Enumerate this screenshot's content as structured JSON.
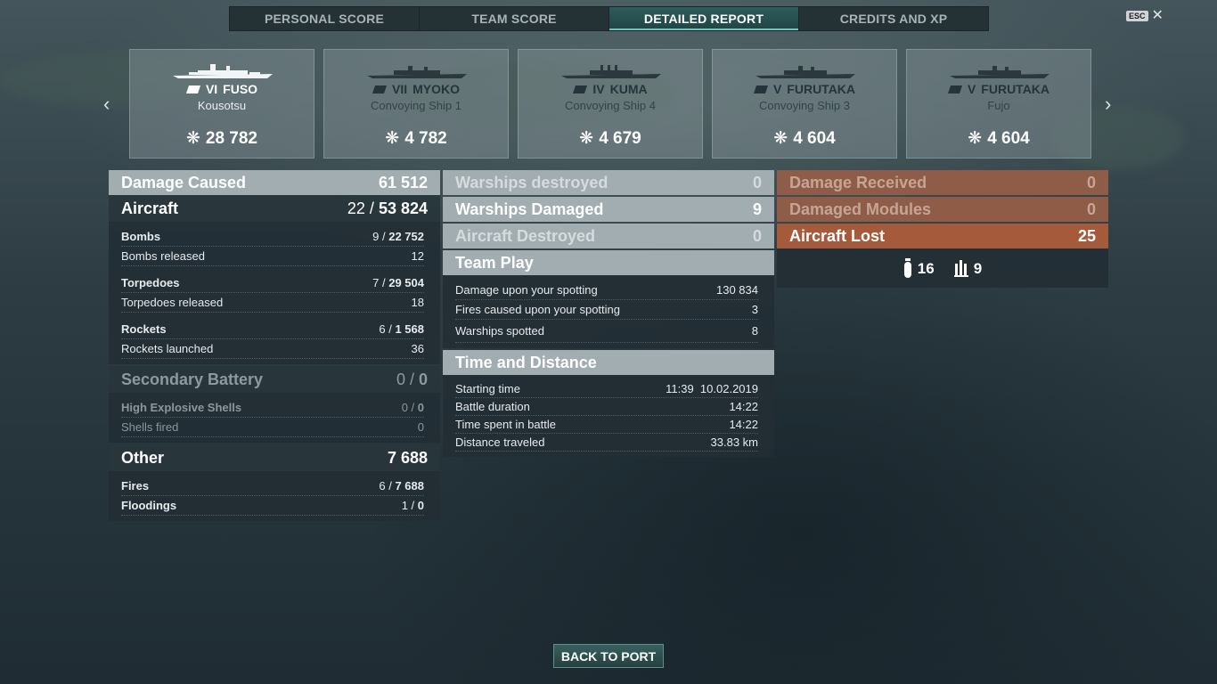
{
  "tabs": [
    "PERSONAL SCORE",
    "TEAM SCORE",
    "DETAILED REPORT",
    "CREDITS AND XP"
  ],
  "esc_label": "ESC",
  "ships": [
    {
      "tier": "VI",
      "name": "FUSO",
      "player": "Kousotsu",
      "damage": "28 782"
    },
    {
      "tier": "VII",
      "name": "MYOKO",
      "player": "Convoying Ship 1",
      "damage": "4 782"
    },
    {
      "tier": "IV",
      "name": "KUMA",
      "player": "Convoying Ship 4",
      "damage": "4 679"
    },
    {
      "tier": "V",
      "name": "FURUTAKA",
      "player": "Convoying Ship 3",
      "damage": "4 604"
    },
    {
      "tier": "V",
      "name": "FURUTAKA",
      "player": "Fujo",
      "damage": "4 604"
    }
  ],
  "damage": {
    "title": "Damage Caused",
    "total": "61 512",
    "aircraft": {
      "label": "Aircraft",
      "hits": "22",
      "value": "53 824"
    },
    "bombs": {
      "label": "Bombs",
      "hits": "9",
      "value": "22 752",
      "released_label": "Bombs released",
      "released": "12"
    },
    "torpedoes": {
      "label": "Torpedoes",
      "hits": "7",
      "value": "29 504",
      "released_label": "Torpedoes released",
      "released": "18"
    },
    "rockets": {
      "label": "Rockets",
      "hits": "6",
      "value": "1 568",
      "launched_label": "Rockets launched",
      "launched": "36"
    },
    "secondary": {
      "label": "Secondary Battery",
      "hits": "0",
      "value": "0",
      "he_label": "High Explosive Shells",
      "he_hits": "0",
      "he_value": "0",
      "fired_label": "Shells fired",
      "fired": "0"
    },
    "other": {
      "label": "Other",
      "total": "7 688",
      "fires_label": "Fires",
      "fires_hits": "6",
      "fires_value": "7 688",
      "flood_label": "Floodings",
      "flood_hits": "1",
      "flood_value": "0"
    }
  },
  "warships": {
    "destroyed_label": "Warships destroyed",
    "destroyed": "0",
    "damaged_label": "Warships Damaged",
    "damaged": "9",
    "aircraft_label": "Aircraft Destroyed",
    "aircraft": "0"
  },
  "team_play": {
    "title": "Team Play",
    "rows": [
      {
        "label": "Damage upon your spotting",
        "value": "130 834"
      },
      {
        "label": "Fires caused upon your spotting",
        "value": "3"
      },
      {
        "label": "Warships spotted",
        "value": "8"
      }
    ]
  },
  "time_distance": {
    "title": "Time and Distance",
    "rows": [
      {
        "label": "Starting time",
        "value": "11:39  10.02.2019"
      },
      {
        "label": "Battle duration",
        "value": "14:22"
      },
      {
        "label": "Time spent in battle",
        "value": "14:22"
      },
      {
        "label": "Distance traveled",
        "value": "33.83 km"
      }
    ]
  },
  "received": {
    "damage_label": "Damage Received",
    "damage": "0",
    "modules_label": "Damaged Modules",
    "modules": "0",
    "aircraft_lost_label": "Aircraft Lost",
    "aircraft_lost": "25",
    "bombs_lost": "16",
    "torpedoes_lost": "9"
  },
  "back_button": "BACK TO PORT"
}
